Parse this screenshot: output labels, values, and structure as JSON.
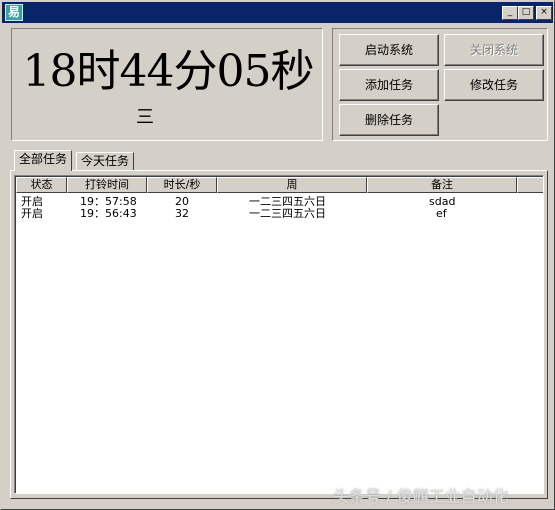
{
  "window": {
    "icon_glyph": "易",
    "controls": {
      "minimize": "_",
      "maximize": "□",
      "close": "×"
    }
  },
  "clock": {
    "time": "18时44分05秒",
    "weekday": "三"
  },
  "buttons": {
    "start": "启动系统",
    "stop": "关闭系统",
    "add": "添加任务",
    "edit": "修改任务",
    "delete": "删除任务"
  },
  "tabs": [
    "全部任务",
    "今天任务"
  ],
  "table": {
    "columns": [
      "状态",
      "打铃时间",
      "时长/秒",
      "周",
      "备注"
    ],
    "rows": [
      [
        "开启",
        "19：57:58",
        "20",
        "一二三四五六日",
        "sdad"
      ],
      [
        "开启",
        "19：56:43",
        "32",
        "一二三四五六日",
        "ef"
      ]
    ]
  },
  "watermark": "头条号 / 俊麒工业自动化"
}
